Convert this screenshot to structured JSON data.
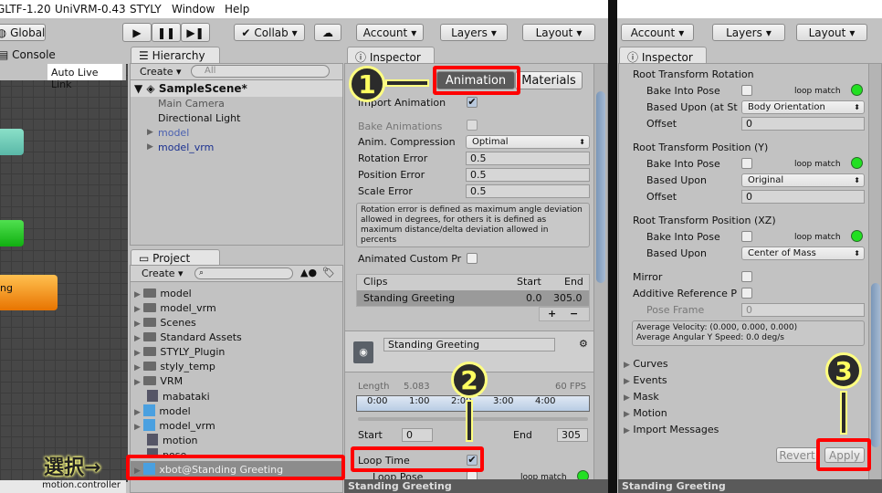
{
  "menu": [
    "GLTF-1.20",
    "UniVRM-0.43",
    "STYLY",
    "Window",
    "Help"
  ],
  "toolbar": {
    "global": "Global",
    "collab": "Collab ▾",
    "account": "Account",
    "layers": "Layers",
    "layout": "Layout"
  },
  "console": {
    "tab": "Console",
    "auto_live_link": "Auto Live Link",
    "node_label": "ng",
    "footer": "motion.controller"
  },
  "hierarchy": {
    "tab": "Hierarchy",
    "create": "Create",
    "search_placeholder": "All",
    "scene": "SampleScene*",
    "items": [
      "Main Camera",
      "Directional Light",
      "model",
      "model_vrm"
    ]
  },
  "project": {
    "tab": "Project",
    "create": "Create",
    "items": [
      "model",
      "model_vrm",
      "Scenes",
      "Standard Assets",
      "STYLY_Plugin",
      "styly_temp",
      "VRM",
      "mabataki",
      "model",
      "model_vrm",
      "motion",
      "pose",
      "xbot@Standing Greeting"
    ]
  },
  "inspector": {
    "tab": "Inspector",
    "tab_animation": "Animation",
    "tab_materials": "Materials",
    "import_animation": "Import Animation",
    "import_animation_checked": true,
    "bake_animations": "Bake Animations",
    "anim_compression": "Anim. Compression",
    "anim_compression_value": "Optimal",
    "rotation_error": "Rotation Error",
    "rotation_error_value": "0.5",
    "position_error": "Position Error",
    "position_error_value": "0.5",
    "scale_error": "Scale Error",
    "scale_error_value": "0.5",
    "help": "Rotation error is defined as maximum angle deviation allowed in degrees, for others it is defined as maximum distance/delta deviation allowed in percents",
    "animated_custom": "Animated Custom Pr",
    "clips_header": [
      "Clips",
      "Start",
      "End"
    ],
    "clip": {
      "name": "Standing Greeting",
      "start": "0.0",
      "end": "305.0"
    },
    "plus": "+",
    "minus": "−",
    "clip_name": "Standing Greeting",
    "length_label": "Length",
    "length": "5.083",
    "fps": "60 FPS",
    "timeline": [
      "0:00",
      "1:00",
      "2:00",
      "3:00",
      "4:00"
    ],
    "start_label": "Start",
    "start": "0",
    "end_label": "End",
    "end": "305",
    "loop_time": "Loop Time",
    "loop_time_checked": true,
    "loop_pose": "Loop Pose",
    "loop_match": "loop match",
    "footer": "Standing Greeting"
  },
  "inspector2": {
    "tab": "Inspector",
    "rtr": "Root Transform Rotation",
    "bake": "Bake Into Pose",
    "loop_match": "loop match",
    "based_upon_start": "Based Upon (at St",
    "based_upon": "Based Upon",
    "offset": "Offset",
    "rtr_based": "Body Orientation",
    "rtr_offset": "0",
    "rty": "Root Transform Position (Y)",
    "rty_based": "Original",
    "rty_offset": "0",
    "rtxz": "Root Transform Position (XZ)",
    "rtxz_based": "Center of Mass",
    "mirror": "Mirror",
    "additive": "Additive Reference P",
    "pose_frame": "Pose Frame",
    "pose_frame_value": "0",
    "avg_velocity": "Average Velocity: (0.000, 0.000, 0.000)",
    "avg_angular": "Average Angular Y Speed: 0.0 deg/s",
    "sections": [
      "Curves",
      "Events",
      "Mask",
      "Motion",
      "Import Messages"
    ],
    "revert": "Revert",
    "apply": "Apply",
    "footer": "Standing Greeting"
  },
  "annotations": {
    "step1": "1",
    "step2": "2",
    "step3": "3",
    "select": "選択→"
  },
  "colors": {
    "highlight": "#ff0000",
    "badge_border": "#ffff80",
    "loop_match": "#22e022"
  }
}
